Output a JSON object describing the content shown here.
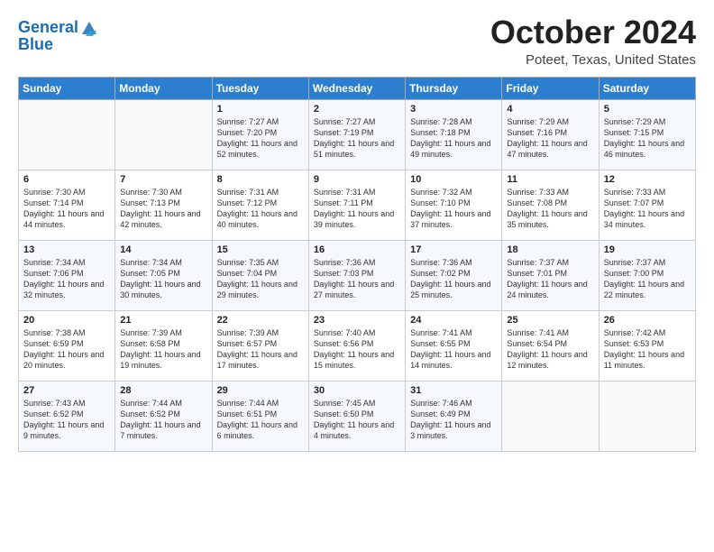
{
  "logo": {
    "line1": "General",
    "line2": "Blue"
  },
  "header": {
    "month": "October 2024",
    "location": "Poteet, Texas, United States"
  },
  "days_of_week": [
    "Sunday",
    "Monday",
    "Tuesday",
    "Wednesday",
    "Thursday",
    "Friday",
    "Saturday"
  ],
  "weeks": [
    [
      {
        "day": "",
        "info": ""
      },
      {
        "day": "",
        "info": ""
      },
      {
        "day": "1",
        "info": "Sunrise: 7:27 AM\nSunset: 7:20 PM\nDaylight: 11 hours and 52 minutes."
      },
      {
        "day": "2",
        "info": "Sunrise: 7:27 AM\nSunset: 7:19 PM\nDaylight: 11 hours and 51 minutes."
      },
      {
        "day": "3",
        "info": "Sunrise: 7:28 AM\nSunset: 7:18 PM\nDaylight: 11 hours and 49 minutes."
      },
      {
        "day": "4",
        "info": "Sunrise: 7:29 AM\nSunset: 7:16 PM\nDaylight: 11 hours and 47 minutes."
      },
      {
        "day": "5",
        "info": "Sunrise: 7:29 AM\nSunset: 7:15 PM\nDaylight: 11 hours and 46 minutes."
      }
    ],
    [
      {
        "day": "6",
        "info": "Sunrise: 7:30 AM\nSunset: 7:14 PM\nDaylight: 11 hours and 44 minutes."
      },
      {
        "day": "7",
        "info": "Sunrise: 7:30 AM\nSunset: 7:13 PM\nDaylight: 11 hours and 42 minutes."
      },
      {
        "day": "8",
        "info": "Sunrise: 7:31 AM\nSunset: 7:12 PM\nDaylight: 11 hours and 40 minutes."
      },
      {
        "day": "9",
        "info": "Sunrise: 7:31 AM\nSunset: 7:11 PM\nDaylight: 11 hours and 39 minutes."
      },
      {
        "day": "10",
        "info": "Sunrise: 7:32 AM\nSunset: 7:10 PM\nDaylight: 11 hours and 37 minutes."
      },
      {
        "day": "11",
        "info": "Sunrise: 7:33 AM\nSunset: 7:08 PM\nDaylight: 11 hours and 35 minutes."
      },
      {
        "day": "12",
        "info": "Sunrise: 7:33 AM\nSunset: 7:07 PM\nDaylight: 11 hours and 34 minutes."
      }
    ],
    [
      {
        "day": "13",
        "info": "Sunrise: 7:34 AM\nSunset: 7:06 PM\nDaylight: 11 hours and 32 minutes."
      },
      {
        "day": "14",
        "info": "Sunrise: 7:34 AM\nSunset: 7:05 PM\nDaylight: 11 hours and 30 minutes."
      },
      {
        "day": "15",
        "info": "Sunrise: 7:35 AM\nSunset: 7:04 PM\nDaylight: 11 hours and 29 minutes."
      },
      {
        "day": "16",
        "info": "Sunrise: 7:36 AM\nSunset: 7:03 PM\nDaylight: 11 hours and 27 minutes."
      },
      {
        "day": "17",
        "info": "Sunrise: 7:36 AM\nSunset: 7:02 PM\nDaylight: 11 hours and 25 minutes."
      },
      {
        "day": "18",
        "info": "Sunrise: 7:37 AM\nSunset: 7:01 PM\nDaylight: 11 hours and 24 minutes."
      },
      {
        "day": "19",
        "info": "Sunrise: 7:37 AM\nSunset: 7:00 PM\nDaylight: 11 hours and 22 minutes."
      }
    ],
    [
      {
        "day": "20",
        "info": "Sunrise: 7:38 AM\nSunset: 6:59 PM\nDaylight: 11 hours and 20 minutes."
      },
      {
        "day": "21",
        "info": "Sunrise: 7:39 AM\nSunset: 6:58 PM\nDaylight: 11 hours and 19 minutes."
      },
      {
        "day": "22",
        "info": "Sunrise: 7:39 AM\nSunset: 6:57 PM\nDaylight: 11 hours and 17 minutes."
      },
      {
        "day": "23",
        "info": "Sunrise: 7:40 AM\nSunset: 6:56 PM\nDaylight: 11 hours and 15 minutes."
      },
      {
        "day": "24",
        "info": "Sunrise: 7:41 AM\nSunset: 6:55 PM\nDaylight: 11 hours and 14 minutes."
      },
      {
        "day": "25",
        "info": "Sunrise: 7:41 AM\nSunset: 6:54 PM\nDaylight: 11 hours and 12 minutes."
      },
      {
        "day": "26",
        "info": "Sunrise: 7:42 AM\nSunset: 6:53 PM\nDaylight: 11 hours and 11 minutes."
      }
    ],
    [
      {
        "day": "27",
        "info": "Sunrise: 7:43 AM\nSunset: 6:52 PM\nDaylight: 11 hours and 9 minutes."
      },
      {
        "day": "28",
        "info": "Sunrise: 7:44 AM\nSunset: 6:52 PM\nDaylight: 11 hours and 7 minutes."
      },
      {
        "day": "29",
        "info": "Sunrise: 7:44 AM\nSunset: 6:51 PM\nDaylight: 11 hours and 6 minutes."
      },
      {
        "day": "30",
        "info": "Sunrise: 7:45 AM\nSunset: 6:50 PM\nDaylight: 11 hours and 4 minutes."
      },
      {
        "day": "31",
        "info": "Sunrise: 7:46 AM\nSunset: 6:49 PM\nDaylight: 11 hours and 3 minutes."
      },
      {
        "day": "",
        "info": ""
      },
      {
        "day": "",
        "info": ""
      }
    ]
  ]
}
